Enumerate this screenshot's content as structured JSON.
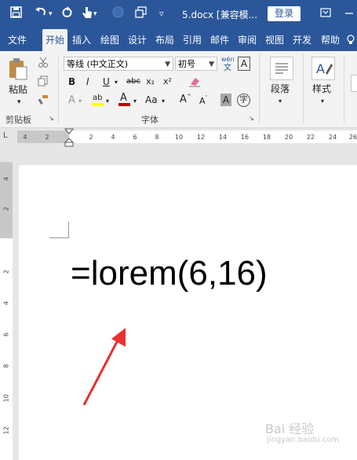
{
  "title_bar": {
    "document_title": "5.docx [兼容模...",
    "login_label": "登录",
    "quick_access_icons": [
      "save-icon",
      "undo-icon",
      "redo-icon",
      "touch-mode-icon",
      "circle-icon",
      "new-window-icon",
      "customize-dropdown-icon"
    ]
  },
  "tabs": [
    {
      "label": "文件",
      "active": false
    },
    {
      "label": "开始",
      "active": true
    },
    {
      "label": "插入",
      "active": false
    },
    {
      "label": "绘图",
      "active": false
    },
    {
      "label": "设计",
      "active": false
    },
    {
      "label": "布局",
      "active": false
    },
    {
      "label": "引用",
      "active": false
    },
    {
      "label": "邮件",
      "active": false
    },
    {
      "label": "审阅",
      "active": false
    },
    {
      "label": "视图",
      "active": false
    },
    {
      "label": "开发",
      "active": false
    },
    {
      "label": "帮助",
      "active": false
    }
  ],
  "ribbon": {
    "clipboard": {
      "paste_label": "粘贴",
      "group_label": "剪贴板"
    },
    "font": {
      "font_name": "等线 (中文正文)",
      "font_size": "初号",
      "phonetic_top": "wén",
      "phonetic_bottom": "文",
      "border_char_label": "A",
      "bold": "B",
      "italic": "I",
      "underline": "U",
      "strikethrough": "abc",
      "subscript": "x₂",
      "superscript": "x²",
      "text_effects": "A",
      "highlight": "ab",
      "font_color": "A",
      "change_case": "Aa",
      "grow_font": "A",
      "shrink_font": "A",
      "char_shading": "A",
      "enclose_char": "字",
      "group_label": "字体"
    },
    "paragraph": {
      "label": "段落"
    },
    "styles": {
      "label": "样式"
    }
  },
  "ruler": {
    "corner": "L",
    "ticks": [
      "4",
      "2",
      "",
      "2",
      "4",
      "6",
      "8",
      "10",
      "12",
      "14",
      "16",
      "18",
      "20",
      "22",
      "24",
      "26"
    ]
  },
  "vruler": {
    "ticks": [
      "4",
      "2",
      "",
      "2",
      "4",
      "6",
      "8",
      "10",
      "12"
    ]
  },
  "document": {
    "text": "=lorem(6,16)"
  },
  "watermark": {
    "text": "Bai 经验",
    "sub": "jingyan.baidu.com"
  },
  "colors": {
    "accent": "#2b579a",
    "highlight_yellow": "#ffff00",
    "font_color_red": "#c00000",
    "arrow_red": "#e8302f"
  }
}
